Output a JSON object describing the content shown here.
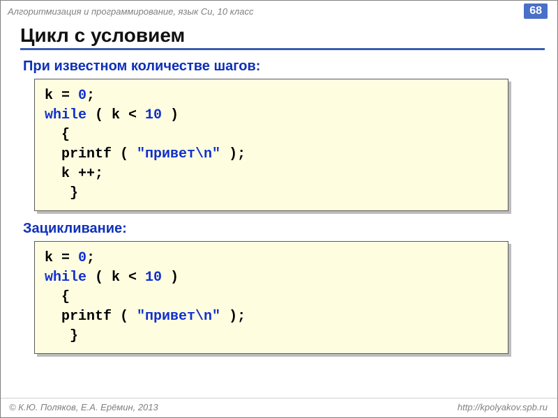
{
  "header": {
    "subject": "Алгоритмизация и программирование, язык Си, 10 класс",
    "page_number": "68"
  },
  "title": "Цикл с условием",
  "sections": [
    {
      "heading": "При известном количестве шагов:",
      "code": [
        [
          {
            "t": "k = "
          },
          {
            "t": "0",
            "c": "num"
          },
          {
            "t": ";"
          }
        ],
        [
          {
            "t": "while",
            "c": "kw"
          },
          {
            "t": " ( k < "
          },
          {
            "t": "10",
            "c": "num"
          },
          {
            "t": " )"
          }
        ],
        [
          {
            "t": "  {"
          }
        ],
        [
          {
            "t": "  printf ( "
          },
          {
            "t": "\"привет\\n\"",
            "c": "str"
          },
          {
            "t": " );"
          }
        ],
        [
          {
            "t": "  k ++;"
          }
        ],
        [
          {
            "t": "   }"
          }
        ]
      ]
    },
    {
      "heading": "Зацикливание:",
      "code": [
        [
          {
            "t": "k = "
          },
          {
            "t": "0",
            "c": "num"
          },
          {
            "t": ";"
          }
        ],
        [
          {
            "t": "while",
            "c": "kw"
          },
          {
            "t": " ( k < "
          },
          {
            "t": "10",
            "c": "num"
          },
          {
            "t": " )"
          }
        ],
        [
          {
            "t": "  {"
          }
        ],
        [
          {
            "t": "  printf ( "
          },
          {
            "t": "\"привет\\n\"",
            "c": "str"
          },
          {
            "t": " );"
          }
        ],
        [
          {
            "t": "   }"
          }
        ]
      ]
    }
  ],
  "footer": {
    "copyright": "© К.Ю. Поляков, Е.А. Ерёмин, 2013",
    "url": "http://kpolyakov.spb.ru"
  }
}
